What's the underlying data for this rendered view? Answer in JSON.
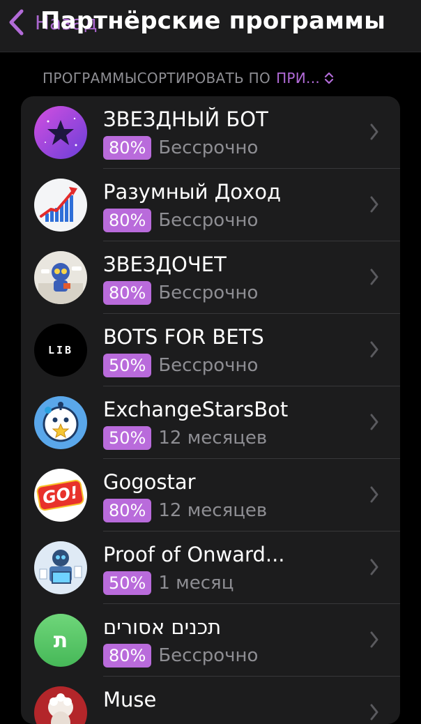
{
  "nav": {
    "back_label": "Назад",
    "title": "Партнёрские программы"
  },
  "section": {
    "label": "ПРОГРАММЫ",
    "sort_prefix": "СОРТИРОВАТЬ ПО",
    "sort_value": "ПРИ..."
  },
  "colors": {
    "accent": "#b26bd8",
    "badge": "#b96bdb",
    "background": "#000000",
    "cell": "#1c1c1d"
  },
  "programs": [
    {
      "name": "ЗВЕЗДНЫЙ БОТ",
      "percent": "80%",
      "duration": "Бессрочно",
      "icon": "star-bot-icon"
    },
    {
      "name": "Разумный Доход",
      "percent": "80%",
      "duration": "Бессрочно",
      "icon": "growth-chart-icon"
    },
    {
      "name": "ЗВЕЗДОЧЕТ",
      "percent": "80%",
      "duration": "Бессрочно",
      "icon": "robot-icon"
    },
    {
      "name": "BOTS FOR BETS",
      "percent": "50%",
      "duration": "Бессрочно",
      "icon": "lib-logo-icon",
      "logo_text": "LIB"
    },
    {
      "name": "ExchangeStarsBot",
      "percent": "50%",
      "duration": "12 месяцев",
      "icon": "star-robot-icon"
    },
    {
      "name": "Gogostar",
      "percent": "80%",
      "duration": "12 месяцев",
      "icon": "go-logo-icon",
      "logo_text": "GO!"
    },
    {
      "name": "Proof of Onward...",
      "percent": "50%",
      "duration": "1 месяц",
      "icon": "robot-laptop-icon"
    },
    {
      "name": "תכנים אסורים",
      "percent": "80%",
      "duration": "Бессрочно",
      "icon": "letter-tav-icon",
      "logo_text": "ת"
    },
    {
      "name": "Muse",
      "percent": "",
      "duration": "",
      "icon": "statue-icon"
    }
  ]
}
